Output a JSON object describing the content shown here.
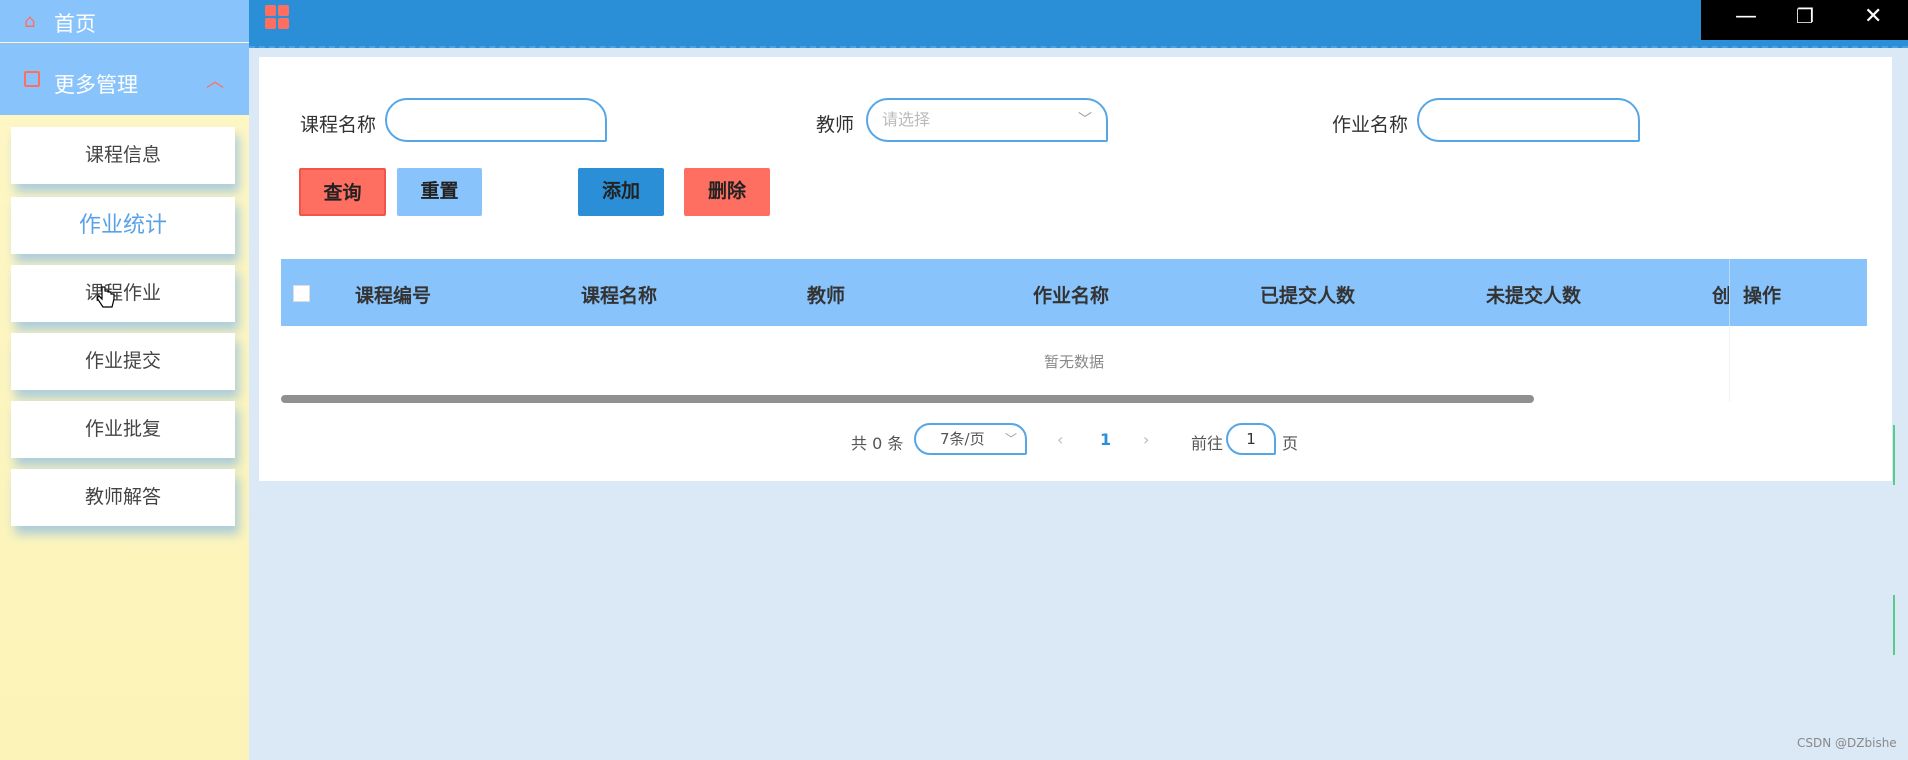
{
  "sidebar": {
    "home_label": "首页",
    "more_label": "更多管理",
    "items": [
      {
        "label": "课程信息"
      },
      {
        "label": "作业统计"
      },
      {
        "label": "课程作业"
      },
      {
        "label": "作业提交"
      },
      {
        "label": "作业批复"
      },
      {
        "label": "教师解答"
      }
    ]
  },
  "window_controls": {
    "minimize": "—",
    "restore": "❐",
    "close": "✕"
  },
  "filters": {
    "course_name_label": "课程名称",
    "teacher_label": "教师",
    "teacher_placeholder": "请选择",
    "homework_name_label": "作业名称"
  },
  "buttons": {
    "query": "查询",
    "reset": "重置",
    "add": "添加",
    "delete": "删除"
  },
  "table": {
    "columns": [
      "课程编号",
      "课程名称",
      "教师",
      "作业名称",
      "已提交人数",
      "未提交人数",
      "创"
    ],
    "action_column": "操作",
    "empty_text": "暂无数据"
  },
  "pagination": {
    "total_text": "共 0 条",
    "page_size": "7条/页",
    "current_page": "1",
    "goto_label": "前往",
    "goto_value": "1",
    "page_suffix": "页"
  },
  "watermark": "CSDN @DZbishe",
  "colors": {
    "accent": "#2a8fd6",
    "sidebar_header": "#89c3fb",
    "danger": "#ff6f61",
    "sidebar_bg": "#fff8c7"
  }
}
